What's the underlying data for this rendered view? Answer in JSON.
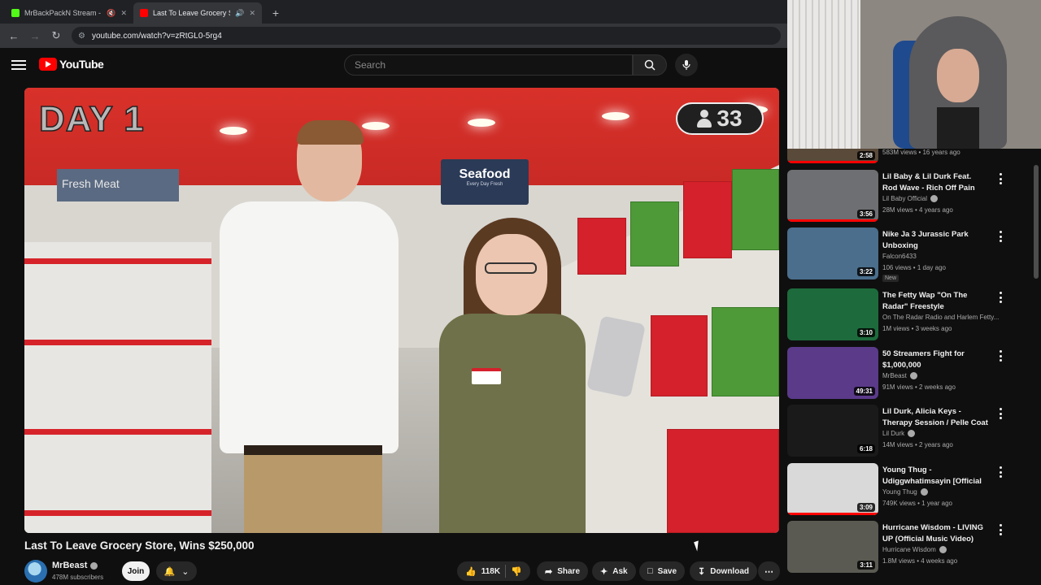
{
  "browser": {
    "tabs": [
      {
        "title": "MrBackPackN Stream - Wa",
        "favicon": "kick-icon",
        "active": false
      },
      {
        "title": "Last To Leave Grocery Store",
        "favicon": "youtube-icon",
        "active": true
      }
    ],
    "url": "youtube.com/watch?v=zRtGL0-5rg4"
  },
  "youtube": {
    "logo_text": "YouTube",
    "search_placeholder": "Search"
  },
  "video": {
    "overlay_day": "DAY 1",
    "overlay_count": "33",
    "store_sign": "Seafood",
    "store_sign_sub": "Every Day Fresh",
    "fresh_sign": "Fresh Meat",
    "title": "Last To Leave Grocery Store, Wins $250,000",
    "channel": "MrBeast",
    "subscribers": "478M subscribers",
    "join_label": "Join",
    "likes": "118K",
    "share_label": "Share",
    "ask_label": "Ask",
    "save_label": "Save",
    "download_label": "Download"
  },
  "sidebar": {
    "partial": {
      "duration": "2:58",
      "meta": "583M views • 16 years ago"
    },
    "items": [
      {
        "title": "Lil Baby & Lil Durk Feat. Rod Wave - Rich Off Pain (Official ...",
        "channel": "Lil Baby Official",
        "meta": "28M views • 4 years ago",
        "duration": "3:56",
        "badge": "",
        "thumb": "#6d6f72"
      },
      {
        "title": "Nike Ja 3 Jurassic Park Unboxing",
        "channel": "Falcon6433",
        "meta": "106 views • 1 day ago",
        "duration": "3:22",
        "badge": "New",
        "thumb": "#4a6e8c"
      },
      {
        "title": "The Fetty Wap \"On The Radar\" Freestyle",
        "channel": "On The Radar Radio and Harlem Fetty...",
        "meta": "1M views • 3 weeks ago",
        "duration": "3:10",
        "badge": "",
        "thumb": "#1d6b3c"
      },
      {
        "title": "50 Streamers Fight for $1,000,000",
        "channel": "MrBeast",
        "meta": "91M views • 2 weeks ago",
        "duration": "49:31",
        "badge": "",
        "thumb": "#5b3a8a"
      },
      {
        "title": "Lil Durk, Alicia Keys - Therapy Session / Pelle Coat (Official ...",
        "channel": "Lil Durk",
        "meta": "14M views • 2 years ago",
        "duration": "6:18",
        "badge": "",
        "thumb": "#1a1a1a"
      },
      {
        "title": "Young Thug - Udiggwhatimsayin [Official Visualizer]",
        "channel": "Young Thug",
        "meta": "749K views • 1 year ago",
        "duration": "3:09",
        "badge": "",
        "thumb": "#d9d9d9"
      },
      {
        "title": "Hurricane Wisdom - LIVING UP (Official Music Video)",
        "channel": "Hurricane Wisdom",
        "meta": "1.8M views • 4 weeks ago",
        "duration": "3:11",
        "badge": "",
        "thumb": "#5a5a52"
      }
    ]
  }
}
